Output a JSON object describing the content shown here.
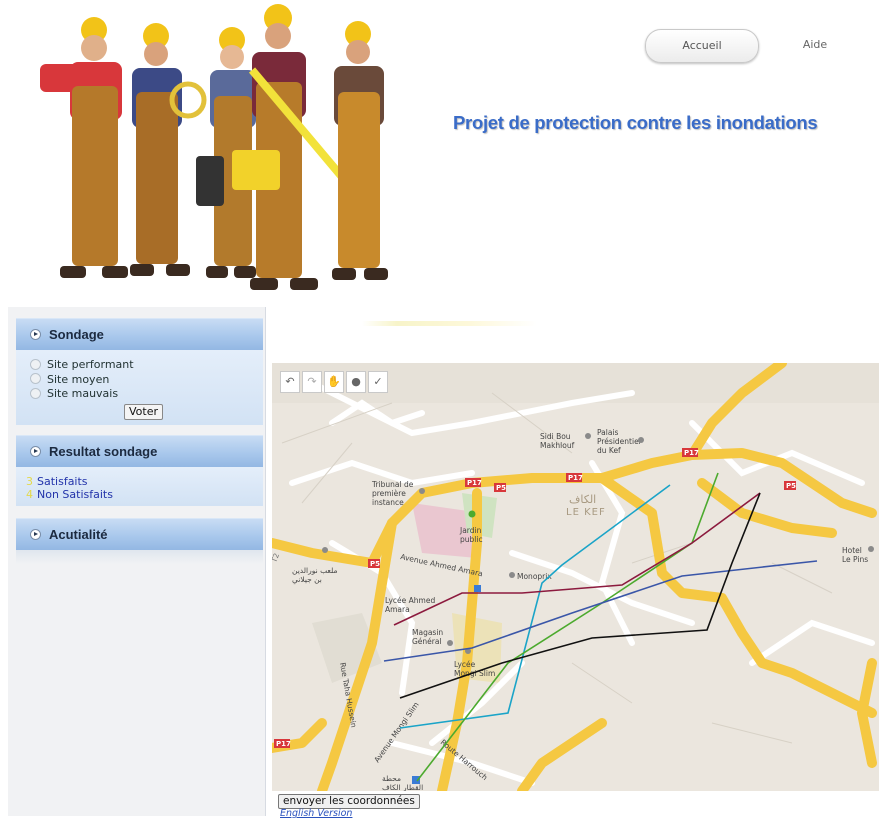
{
  "header": {
    "nav": [
      {
        "label": "Accueil"
      },
      {
        "label": "Aide"
      }
    ],
    "title": "Projet de protection contre les inondations",
    "hero_image": "construction-workers-illustration"
  },
  "sidebar": {
    "sondage": {
      "title": "Sondage",
      "options": [
        {
          "label": "Site performant",
          "checked": false
        },
        {
          "label": "Site moyen",
          "checked": false
        },
        {
          "label": "Site mauvais",
          "checked": false
        }
      ],
      "vote_label": "Voter"
    },
    "resultat": {
      "title": "Resultat sondage",
      "rows": [
        {
          "count": "3",
          "label": "Satisfaits"
        },
        {
          "count": "4",
          "label": "Non Satisfaits"
        }
      ]
    },
    "actualite": {
      "title": "Acutialité"
    }
  },
  "map": {
    "toolbar": [
      {
        "icon": "undo-arrow-icon"
      },
      {
        "icon": "redo-arrow-icon"
      },
      {
        "icon": "hand-pan-icon"
      },
      {
        "icon": "marker-pin-icon"
      },
      {
        "icon": "line-draw-icon"
      }
    ],
    "labels": {
      "sidi_bou": "Sidi Bou\nMakhlouf",
      "palais": "Palais\nPrésidentiel\ndu Kef",
      "tribunal": "Tribunal de\npremière\ninstance",
      "lekef_ar": "الكاف",
      "lekef": "LE KEF",
      "jardin": "Jardin\npublic",
      "ahmed_amara": "Avenue Ahmed Amara",
      "monoprix": "Monoprix",
      "lycee_ahmed": "Lycée Ahmed\nAmara",
      "magasin": "Magasin\nGénéral",
      "lycee_mongi": "Lycée\nMongi Slim",
      "hotel": "Hotel\nLe Pins",
      "taha": "Rue Taha Hussein",
      "mongi_ave": "Avenue Mongi Slim",
      "harrouch": "Route Harrouch",
      "malab": "ملعب نورالدين\nبن جيلاني",
      "mahatta": "محطة\nالقطار الكاف",
      "p17": "P17",
      "p5": "P5",
      "t2": "T2"
    },
    "drawn_lines": [
      {
        "color": "#1aa4c8"
      },
      {
        "color": "#4caa2e"
      },
      {
        "color": "#8c1a3e"
      },
      {
        "color": "#3a56a8"
      },
      {
        "color": "#111111"
      }
    ]
  },
  "footer": {
    "send_label": "envoyer les coordonnées",
    "english_label": "English Version"
  },
  "colors": {
    "title_blue": "#3a6cc8",
    "sidebar_header": "#a9c8ec",
    "road_yellow": "#f5c842"
  }
}
